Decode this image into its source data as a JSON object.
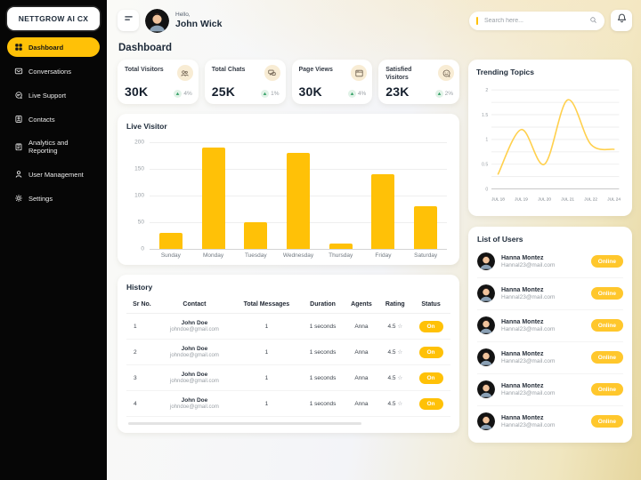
{
  "brand": "NETTGROW AI CX",
  "sidebar": {
    "items": [
      {
        "label": "Dashboard",
        "icon": "dashboard-grid-icon",
        "active": true
      },
      {
        "label": "Conversations",
        "icon": "conversations-icon",
        "active": false
      },
      {
        "label": "Live Support",
        "icon": "live-support-icon",
        "active": false
      },
      {
        "label": "Contacts",
        "icon": "contacts-icon",
        "active": false
      },
      {
        "label": "Analytics and Reporting",
        "icon": "analytics-icon",
        "active": false
      },
      {
        "label": "User Management",
        "icon": "user-management-icon",
        "active": false
      },
      {
        "label": "Settings",
        "icon": "settings-icon",
        "active": false
      }
    ]
  },
  "header": {
    "greeting": "Hello,",
    "username": "John Wick",
    "search_placeholder": "Search here...",
    "menu_icon": "hamburger-icon",
    "search_icon": "search-icon",
    "bell_icon": "bell-icon"
  },
  "page_title": "Dashboard",
  "stats": [
    {
      "label": "Total Visitors",
      "value": "30K",
      "delta": "4%",
      "icon": "visitors-icon"
    },
    {
      "label": "Total Chats",
      "value": "25K",
      "delta": "1%",
      "icon": "chats-icon"
    },
    {
      "label": "Page Views",
      "value": "30K",
      "delta": "4%",
      "icon": "pageviews-icon"
    },
    {
      "label": "Satisfied Visitors",
      "value": "23K",
      "delta": "2%",
      "icon": "satisfied-icon"
    }
  ],
  "chart_data": [
    {
      "type": "bar",
      "title": "Live Visitor",
      "categories": [
        "Sunday",
        "Monday",
        "Tuesday",
        "Wednesday",
        "Thursday",
        "Friday",
        "Saturday"
      ],
      "values": [
        30,
        190,
        50,
        180,
        10,
        140,
        80
      ],
      "xlabel": "",
      "ylabel": "",
      "ylim": [
        0,
        200
      ],
      "yticks": [
        0,
        50,
        100,
        150,
        200
      ],
      "grid": true,
      "bar_color": "#FFC107"
    },
    {
      "type": "line",
      "title": "Trending Topics",
      "x": [
        "JUL 18",
        "JUL 19",
        "JUL 20",
        "JUL 21",
        "JUL 22",
        "JUL 24"
      ],
      "values": [
        0.3,
        1.2,
        0.5,
        1.8,
        0.9,
        0.8
      ],
      "xlabel": "",
      "ylabel": "",
      "ylim": [
        0,
        2
      ],
      "yticks": [
        0,
        0.5,
        1,
        1.5,
        2
      ],
      "minor_grid_step": 0.25,
      "grid": true,
      "line_color": "#FFD04D"
    }
  ],
  "history": {
    "title": "History",
    "columns": [
      "Sr No.",
      "Contact",
      "Total Messages",
      "Duration",
      "Agents",
      "Rating",
      "Status"
    ],
    "rows": [
      {
        "sr": "1",
        "name": "John Doe",
        "email": "johndoe@gmail.com",
        "messages": "1",
        "duration": "1 seconds",
        "agent": "Anna",
        "rating": "4.5",
        "status": "On"
      },
      {
        "sr": "2",
        "name": "John Doe",
        "email": "johndoe@gmail.com",
        "messages": "1",
        "duration": "1 seconds",
        "agent": "Anna",
        "rating": "4.5",
        "status": "On"
      },
      {
        "sr": "3",
        "name": "John Doe",
        "email": "johndoe@gmail.com",
        "messages": "1",
        "duration": "1 seconds",
        "agent": "Anna",
        "rating": "4.5",
        "status": "On"
      },
      {
        "sr": "4",
        "name": "John Doe",
        "email": "johndoe@gmail.com",
        "messages": "1",
        "duration": "1 seconds",
        "agent": "Anna",
        "rating": "4.5",
        "status": "On"
      }
    ]
  },
  "users": {
    "title": "List of Users",
    "rows": [
      {
        "name": "Hanna Montez",
        "email": "Hannal23@mail.com",
        "status": "Online"
      },
      {
        "name": "Hanna Montez",
        "email": "Hannal23@mail.com",
        "status": "Online"
      },
      {
        "name": "Hanna Montez",
        "email": "Hannal23@mail.com",
        "status": "Online"
      },
      {
        "name": "Hanna Montez",
        "email": "Hannal23@mail.com",
        "status": "Online"
      },
      {
        "name": "Hanna Montez",
        "email": "Hannal23@mail.com",
        "status": "Online"
      },
      {
        "name": "Hanna Montez",
        "email": "Hannal23@mail.com",
        "status": "Online"
      }
    ]
  },
  "colors": {
    "accent": "#FFC107",
    "online_badge": "#FFC72C",
    "positive_green": "#2f9e63",
    "sidebar_bg": "#060606",
    "text_dark": "#1D2A39",
    "text_gray": "#8A8F98"
  }
}
